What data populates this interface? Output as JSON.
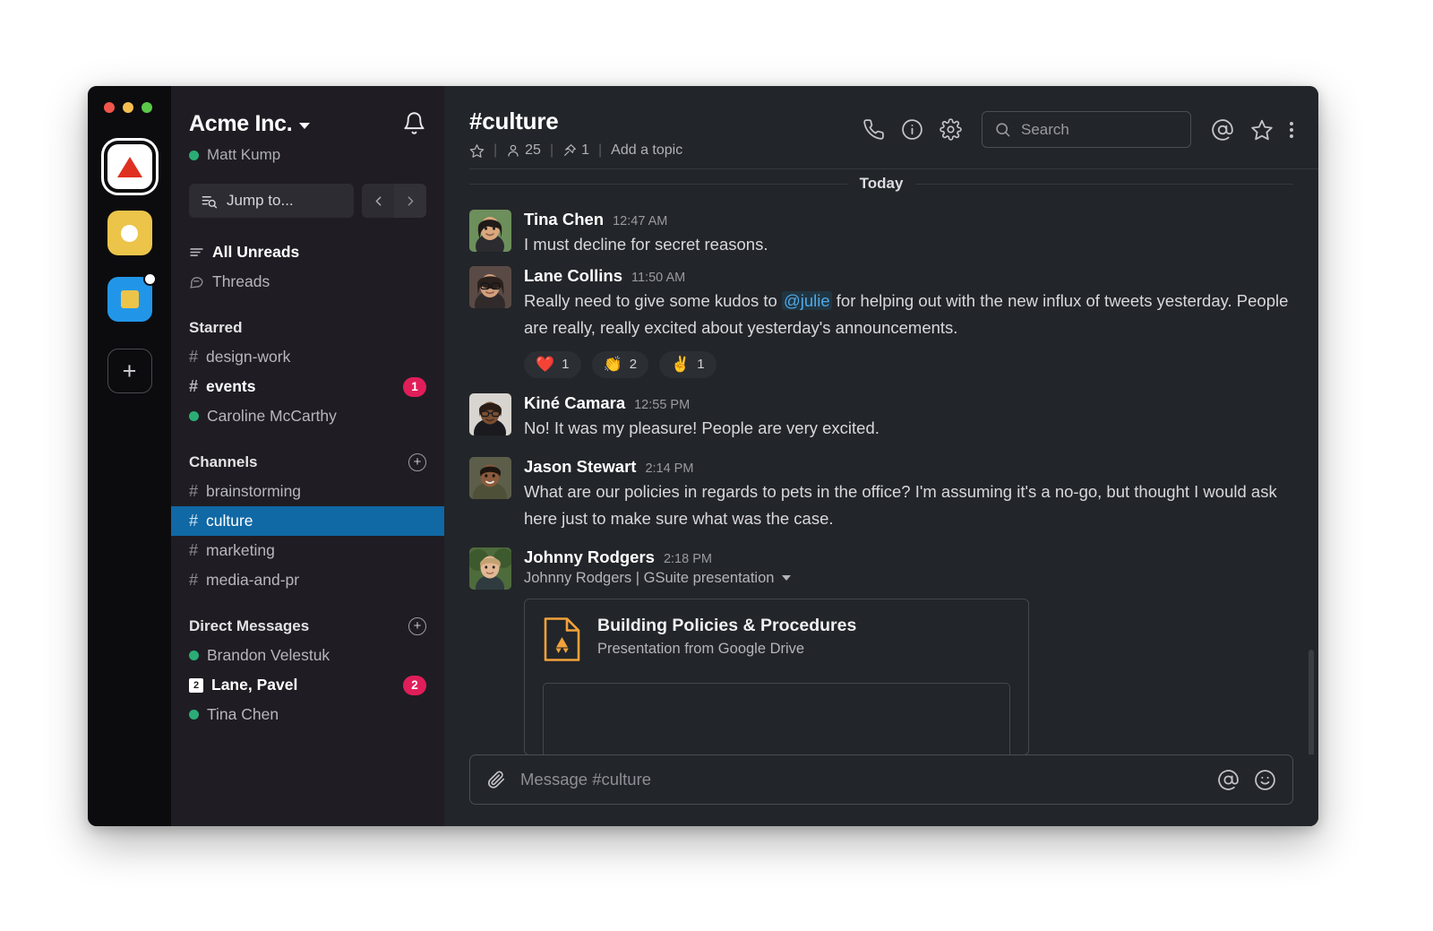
{
  "window": {
    "traffic_lights": [
      "close",
      "minimize",
      "zoom"
    ]
  },
  "rail": {
    "workspaces": [
      {
        "name": "acme-workspace",
        "icon": "red-triangle-logo",
        "color": "#E03020",
        "active": true,
        "unread": false
      },
      {
        "name": "yellow-workspace",
        "icon": "white-circle-logo",
        "color": "#ECC44A",
        "active": false,
        "unread": false
      },
      {
        "name": "blue-workspace",
        "icon": "yellow-square-logo",
        "color": "#2196E8",
        "active": false,
        "unread": true
      }
    ],
    "add_label": "+"
  },
  "sidebar": {
    "workspace_name": "Acme Inc.",
    "user_name": "Matt Kump",
    "user_presence": "active",
    "jump_to_placeholder": "Jump to...",
    "nav_back": "‹",
    "nav_forward": "›",
    "quick": [
      {
        "label": "All Unreads",
        "icon": "unreads-icon",
        "bold": true
      },
      {
        "label": "Threads",
        "icon": "threads-icon",
        "bold": false
      }
    ],
    "starred": {
      "title": "Starred",
      "items": [
        {
          "label": "design-work",
          "type": "channel",
          "bold": false,
          "badge": null
        },
        {
          "label": "events",
          "type": "channel",
          "bold": true,
          "badge": "1"
        },
        {
          "label": "Caroline McCarthy",
          "type": "dm",
          "presence": "active",
          "bold": false,
          "badge": null
        }
      ]
    },
    "channels": {
      "title": "Channels",
      "add_label": "+",
      "items": [
        {
          "label": "brainstorming",
          "type": "channel",
          "selected": false,
          "bold": false,
          "badge": null
        },
        {
          "label": "culture",
          "type": "channel",
          "selected": true,
          "bold": false,
          "badge": null
        },
        {
          "label": "marketing",
          "type": "channel",
          "selected": false,
          "bold": false,
          "badge": null
        },
        {
          "label": "media-and-pr",
          "type": "channel",
          "selected": false,
          "bold": false,
          "badge": null
        }
      ]
    },
    "direct_messages": {
      "title": "Direct Messages",
      "add_label": "+",
      "items": [
        {
          "label": "Brandon Velestuk",
          "type": "dm",
          "presence": "active",
          "bold": false,
          "badge": null,
          "group_count": null
        },
        {
          "label": "Lane, Pavel",
          "type": "group",
          "presence": null,
          "bold": true,
          "badge": "2",
          "group_count": "2"
        },
        {
          "label": "Tina Chen",
          "type": "dm",
          "presence": "active",
          "bold": false,
          "badge": null,
          "group_count": null
        }
      ]
    }
  },
  "channel_header": {
    "name": "#culture",
    "star_icon": "star-icon",
    "member_icon": "members-icon",
    "member_count": "25",
    "pin_icon": "pin-icon",
    "pin_count": "1",
    "topic_placeholder": "Add a topic",
    "actions": [
      {
        "name": "call-button",
        "icon": "phone-icon"
      },
      {
        "name": "channel-info-button",
        "icon": "info-icon"
      },
      {
        "name": "channel-settings-button",
        "icon": "gear-icon"
      }
    ],
    "search_placeholder": "Search",
    "right_actions": [
      {
        "name": "mentions-button",
        "icon": "at-icon"
      },
      {
        "name": "starred-items-button",
        "icon": "star-icon"
      },
      {
        "name": "more-options-button",
        "icon": "kebab-icon"
      }
    ]
  },
  "conversation": {
    "date_divider": "Today",
    "messages": [
      {
        "author": "Tina Chen",
        "timestamp": "12:47 AM",
        "avatar": "tina-chen-avatar",
        "text": "I must decline for secret reasons.",
        "mention": null,
        "reactions": []
      },
      {
        "author": "Lane Collins",
        "timestamp": "11:50 AM",
        "avatar": "lane-collins-avatar",
        "text_before": "Really need to give some kudos to ",
        "mention": "@julie",
        "text_after": " for helping out with the new influx of tweets yesterday. People are really, really excited about yesterday's announcements.",
        "reactions": [
          {
            "emoji": "❤️",
            "name": "heart-reaction",
            "count": "1"
          },
          {
            "emoji": "👏",
            "name": "clap-reaction",
            "count": "2"
          },
          {
            "emoji": "✌️",
            "name": "victory-hand-reaction",
            "count": "1"
          }
        ]
      },
      {
        "author": "Kiné Camara",
        "timestamp": "12:55 PM",
        "avatar": "kine-camara-avatar",
        "text": "No! It was my pleasure! People are very excited.",
        "reactions": []
      },
      {
        "author": "Jason Stewart",
        "timestamp": "2:14 PM",
        "avatar": "jason-stewart-avatar",
        "text": "What are our policies in regards to pets in the office? I'm assuming it's a no-go, but thought I would ask here just to make sure what was the case.",
        "reactions": []
      },
      {
        "author": "Johnny Rodgers",
        "timestamp": "2:18 PM",
        "avatar": "johnny-rodgers-avatar",
        "subline": "Johnny Rodgers | GSuite presentation",
        "attachment": {
          "icon": "google-drive-icon",
          "icon_color": "#F2A23B",
          "title": "Building Policies & Procedures",
          "subtitle": "Presentation from Google Drive"
        },
        "reactions": []
      }
    ]
  },
  "composer": {
    "attach_icon": "paperclip-icon",
    "placeholder": "Message #culture",
    "mention_icon": "at-icon",
    "emoji_icon": "emoji-icon"
  },
  "colors": {
    "rail_bg": "#0C0C0E",
    "sidebar_bg": "#1F1D23",
    "main_bg": "#222529",
    "selected_channel": "#1068A5",
    "badge": "#E01E5A",
    "presence_active": "#2BAC76",
    "mention_link": "#4FA9E8",
    "drive_orange": "#F2A23B"
  }
}
